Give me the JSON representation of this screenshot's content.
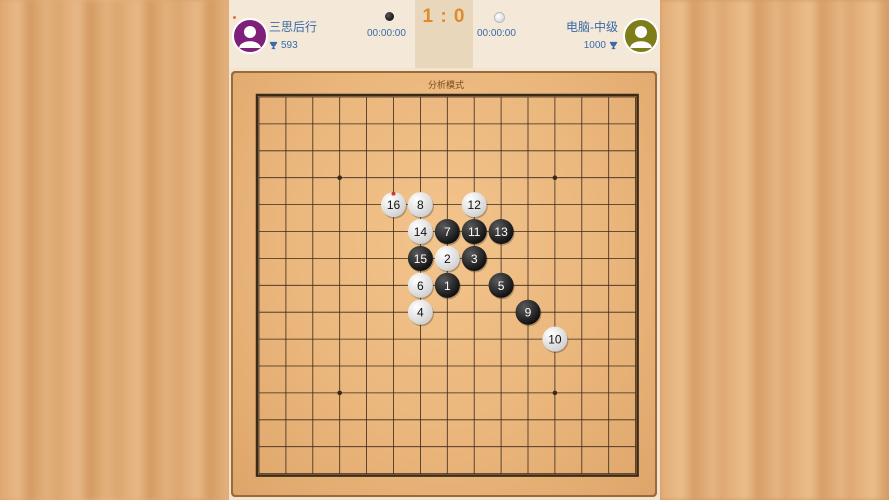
{
  "player1": {
    "name": "三思后行",
    "score": "593",
    "timer": "00:00:00",
    "avatar_color": "#7e1f7a"
  },
  "player2": {
    "name": "电脑-中级",
    "score": "1000",
    "timer": "00:00:00",
    "avatar_color": "#7d7d1a"
  },
  "match_score": "1 : 0",
  "board": {
    "title": "分析模式",
    "size": 15,
    "star_points": [
      [
        3,
        3
      ],
      [
        11,
        3
      ],
      [
        3,
        11
      ],
      [
        11,
        11
      ]
    ],
    "last_move_marker": 16,
    "moves": [
      {
        "n": "1",
        "color": "black",
        "col": 7,
        "row": 7
      },
      {
        "n": "2",
        "color": "white",
        "col": 7,
        "row": 6
      },
      {
        "n": "3",
        "color": "black",
        "col": 8,
        "row": 6
      },
      {
        "n": "4",
        "color": "white",
        "col": 6,
        "row": 8
      },
      {
        "n": "5",
        "color": "black",
        "col": 9,
        "row": 7
      },
      {
        "n": "6",
        "color": "white",
        "col": 6,
        "row": 7
      },
      {
        "n": "7",
        "color": "black",
        "col": 7,
        "row": 5
      },
      {
        "n": "8",
        "color": "white",
        "col": 6,
        "row": 4
      },
      {
        "n": "9",
        "color": "black",
        "col": 10,
        "row": 8
      },
      {
        "n": "10",
        "color": "white",
        "col": 11,
        "row": 9
      },
      {
        "n": "11",
        "color": "black",
        "col": 8,
        "row": 5
      },
      {
        "n": "12",
        "color": "white",
        "col": 8,
        "row": 4
      },
      {
        "n": "13",
        "color": "black",
        "col": 9,
        "row": 5
      },
      {
        "n": "14",
        "color": "white",
        "col": 6,
        "row": 5
      },
      {
        "n": "15",
        "color": "black",
        "col": 6,
        "row": 6
      },
      {
        "n": "16",
        "color": "white",
        "col": 5,
        "row": 4
      }
    ]
  },
  "colors": {
    "black_stone": "#111111",
    "white_stone": "#f4f4f4",
    "grid_line": "#3a2a1a",
    "last_move": "#d23a2a",
    "score": "#e08a2a",
    "text": "#3a6aa8"
  }
}
